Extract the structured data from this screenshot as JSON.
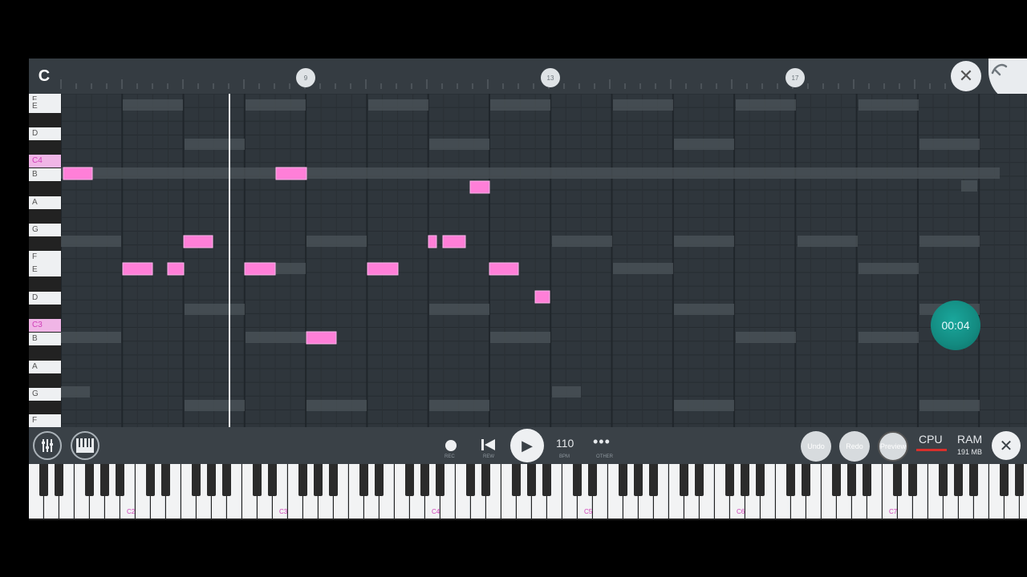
{
  "ruler": {
    "logo": "C",
    "markers": [
      "9",
      "13",
      "17"
    ]
  },
  "side_keyboard": {
    "labels": [
      {
        "text": "F",
        "highlight": false
      },
      {
        "text": "E",
        "highlight": false
      },
      {
        "text": "D",
        "highlight": false
      },
      {
        "text": "C4",
        "highlight": true
      },
      {
        "text": "B",
        "highlight": false
      },
      {
        "text": "A",
        "highlight": false
      },
      {
        "text": "G",
        "highlight": false
      },
      {
        "text": "F",
        "highlight": false
      },
      {
        "text": "E",
        "highlight": false
      },
      {
        "text": "D",
        "highlight": false
      },
      {
        "text": "C3",
        "highlight": true
      },
      {
        "text": "B",
        "highlight": false
      },
      {
        "text": "A",
        "highlight": false
      },
      {
        "text": "G",
        "highlight": false
      },
      {
        "text": "F",
        "highlight": false
      }
    ]
  },
  "playhead_time": "00:04",
  "toolbar": {
    "tempo": "110",
    "tempo_sub": "BPM",
    "rec_sub": "REC",
    "rew_sub": "REW",
    "more_sub": "OTHER",
    "undo": "Undo",
    "redo": "Redo",
    "preview": "Preview",
    "cpu": "CPU",
    "ram": "RAM",
    "ram_value": "191 MB"
  },
  "keyboard": {
    "octave_labels": [
      "C2",
      "C3",
      "C4",
      "C5",
      "C6",
      "C7"
    ]
  },
  "colors": {
    "note": "#ff7fd8",
    "ghost_note": "#4c545a",
    "accent": "#d13fb9",
    "teal": "#16998f"
  }
}
